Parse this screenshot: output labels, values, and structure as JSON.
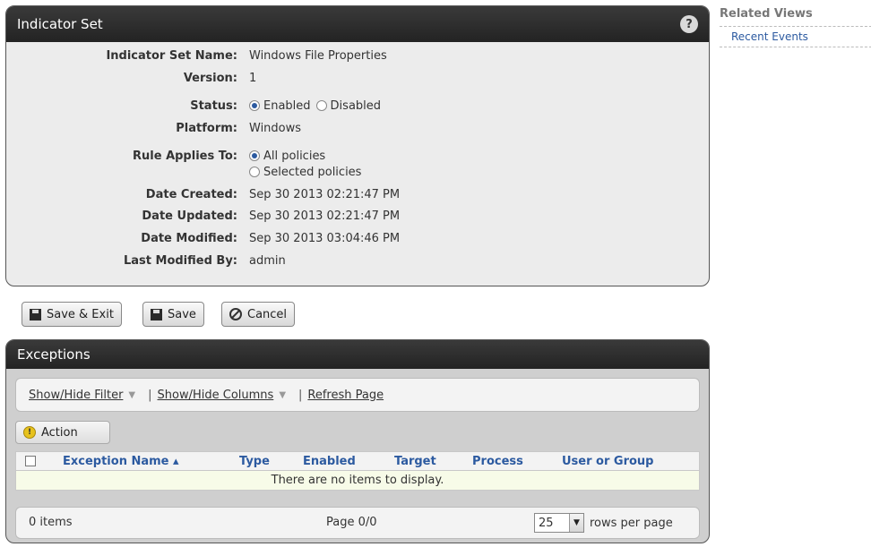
{
  "indicator_panel": {
    "title": "Indicator Set",
    "help_icon": "?",
    "fields": {
      "name_label": "Indicator Set Name:",
      "name_value": "Windows File Properties",
      "version_label": "Version:",
      "version_value": "1",
      "status_label": "Status:",
      "status_enabled": "Enabled",
      "status_disabled": "Disabled",
      "status_selected": "Enabled",
      "platform_label": "Platform:",
      "platform_value": "Windows",
      "rule_label": "Rule Applies To:",
      "rule_all": "All policies",
      "rule_selected": "Selected policies",
      "rule_current": "All policies",
      "created_label": "Date Created:",
      "created_value": "Sep 30 2013 02:21:47 PM",
      "updated_label": "Date Updated:",
      "updated_value": "Sep 30 2013 02:21:47 PM",
      "modified_label": "Date Modified:",
      "modified_value": "Sep 30 2013 03:04:46 PM",
      "modified_by_label": "Last Modified By:",
      "modified_by_value": "admin"
    }
  },
  "buttons": {
    "save_exit": "Save & Exit",
    "save": "Save",
    "cancel": "Cancel"
  },
  "exceptions": {
    "title": "Exceptions",
    "toolbar": {
      "show_hide_filter": "Show/Hide Filter",
      "show_hide_columns": "Show/Hide Columns",
      "refresh_page": "Refresh Page"
    },
    "action_label": "Action",
    "columns": [
      "Exception Name ▴",
      "Type",
      "Enabled",
      "Target",
      "Process",
      "User or Group"
    ],
    "empty_message": "There are no items to display.",
    "footer": {
      "items": "0 items",
      "page": "Page 0/0",
      "rows_value": "25",
      "rows_label": "rows per page"
    }
  },
  "related_views": {
    "title": "Related Views",
    "links": [
      "Recent Events"
    ]
  },
  "colors": {
    "header_bg": "#2a2a2a",
    "accent_blue": "#2c5aa0",
    "empty_row_bg": "#f7fbe8"
  }
}
